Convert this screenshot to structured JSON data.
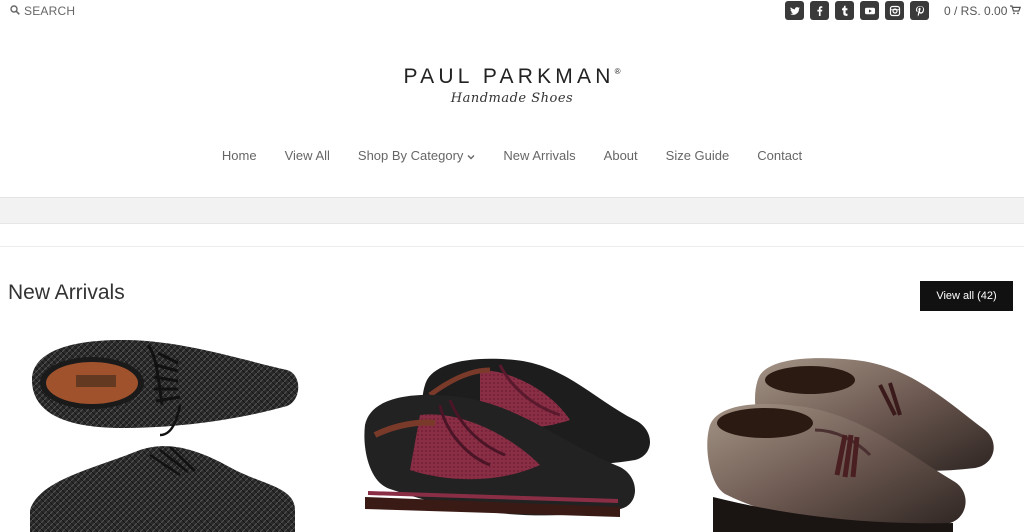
{
  "header": {
    "search_label": "SEARCH",
    "social_icons": [
      "twitter-icon",
      "facebook-icon",
      "tumblr-icon",
      "youtube-icon",
      "instagram-icon",
      "pinterest-icon"
    ],
    "cart_text": "0 / RS. 0.00"
  },
  "logo": {
    "brand": "PAUL PARKMAN",
    "registered": "®",
    "tagline": "Handmade Shoes"
  },
  "nav": {
    "items": [
      "Home",
      "View All",
      "Shop By Category",
      "New Arrivals",
      "About",
      "Size Guide",
      "Contact"
    ]
  },
  "section": {
    "title": "New Arrivals",
    "view_all_label": "View all (42)"
  },
  "products": [
    {
      "image": "black-woven-oxford-image"
    },
    {
      "image": "burgundy-black-wingtip-derby-image"
    },
    {
      "image": "brown-tassel-loafer-image"
    }
  ],
  "colors": {
    "accent": "#111111",
    "nav_text": "#666666",
    "band": "#f2f2f2"
  }
}
